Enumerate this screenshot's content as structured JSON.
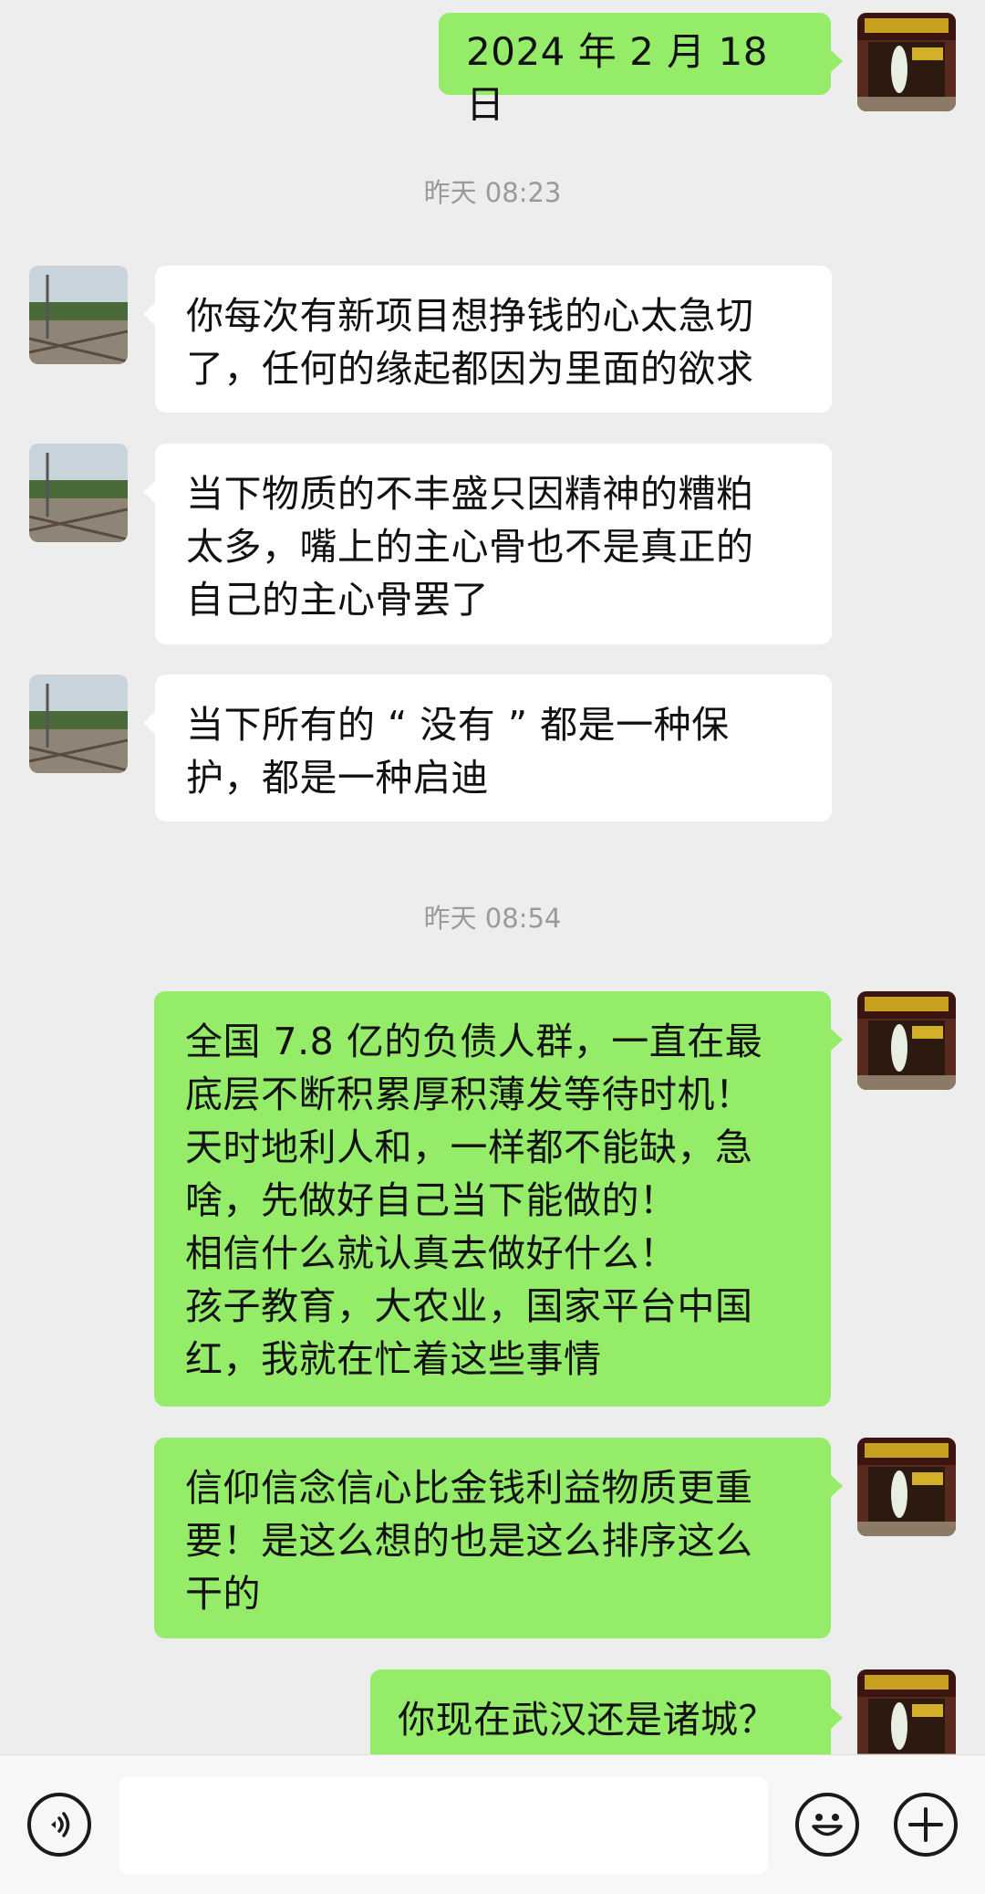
{
  "timestamps": [
    "昨天 08:23",
    "昨天 08:54"
  ],
  "messages": [
    {
      "side": "out",
      "text": "2024 年 2 月 18 日"
    },
    {
      "side": "in",
      "text": "你每次有新项目想挣钱的心太急切\n了，任何的缘起都因为里面的欲求"
    },
    {
      "side": "in",
      "text": "当下物质的不丰盛只因精神的糟粕\n太多，嘴上的主心骨也不是真正的\n自己的主心骨罢了"
    },
    {
      "side": "in",
      "text": "当下所有的 “ 没有 ” 都是一种保\n护，都是一种启迪"
    },
    {
      "side": "out",
      "text": "全国 7.8 亿的负债人群，一直在最\n底层不断积累厚积薄发等待时机！\n天时地利人和，一样都不能缺，急\n啥，先做好自己当下能做的！\n相信什么就认真去做好什么！\n孩子教育，大农业，国家平台中国\n红，我就在忙着这些事情"
    },
    {
      "side": "out",
      "text": "信仰信念信心比金钱利益物质更重\n要！是这么想的也是这么排序这么\n干的"
    },
    {
      "side": "out",
      "text": "你现在武汉还是诸城？"
    }
  ],
  "input_bar": {
    "voice_icon": "voice-icon",
    "emoji_icon": "emoji-icon",
    "plus_icon": "plus-icon"
  },
  "colors": {
    "background": "#ededed",
    "outgoing_bubble": "#95ec69",
    "incoming_bubble": "#ffffff"
  }
}
